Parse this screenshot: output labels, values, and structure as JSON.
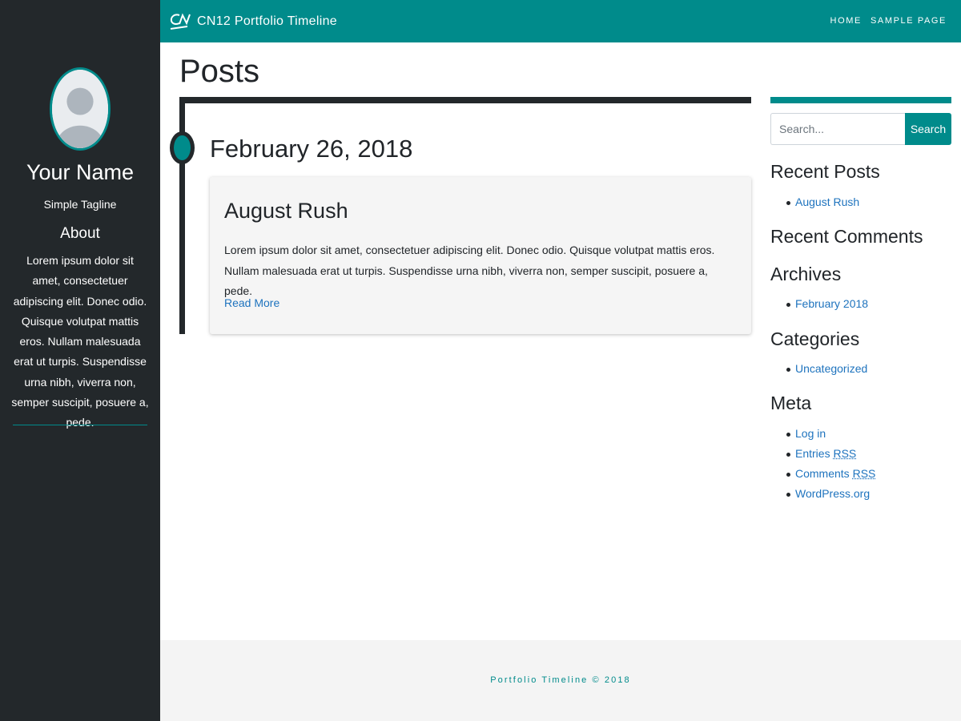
{
  "profile": {
    "name": "Your Name",
    "tagline": "Simple Tagline",
    "about_title": "About",
    "about_text": "Lorem ipsum dolor sit amet, consectetuer adipiscing elit. Donec odio. Quisque volutpat mattis eros. Nullam malesuada erat ut turpis. Suspendisse urna nibh, viverra non, semper suscipit, posuere a, pede."
  },
  "navbar": {
    "brand_text": "CN12 Portfolio Timeline",
    "links": [
      "HOME",
      "SAMPLE PAGE"
    ]
  },
  "main": {
    "page_title": "Posts",
    "timeline_date": "February 26, 2018",
    "post": {
      "title": "August Rush",
      "excerpt": "Lorem ipsum dolor sit amet, consectetuer adipiscing elit. Donec odio. Quisque volutpat mattis eros. Nullam malesuada erat ut turpis. Suspendisse urna nibh, viverra non, semper suscipit, posuere a, pede.",
      "read_more": "Read More"
    }
  },
  "sidebar": {
    "search": {
      "placeholder": "Search...",
      "button_label": "Search"
    },
    "recent_posts": {
      "title": "Recent Posts",
      "items": [
        "August Rush"
      ]
    },
    "recent_comments": {
      "title": "Recent Comments"
    },
    "archives": {
      "title": "Archives",
      "items": [
        "February 2018"
      ]
    },
    "categories": {
      "title": "Categories",
      "items": [
        "Uncategorized"
      ]
    },
    "meta": {
      "title": "Meta",
      "login": "Log in",
      "entries_prefix": "Entries ",
      "comments_prefix": "Comments ",
      "rss": "RSS",
      "wordpress": "WordPress.org"
    }
  },
  "footer": {
    "text": "Portfolio Timeline © 2018"
  },
  "colors": {
    "accent": "#008b8b",
    "dark": "#23282b",
    "link": "#1e73be"
  }
}
